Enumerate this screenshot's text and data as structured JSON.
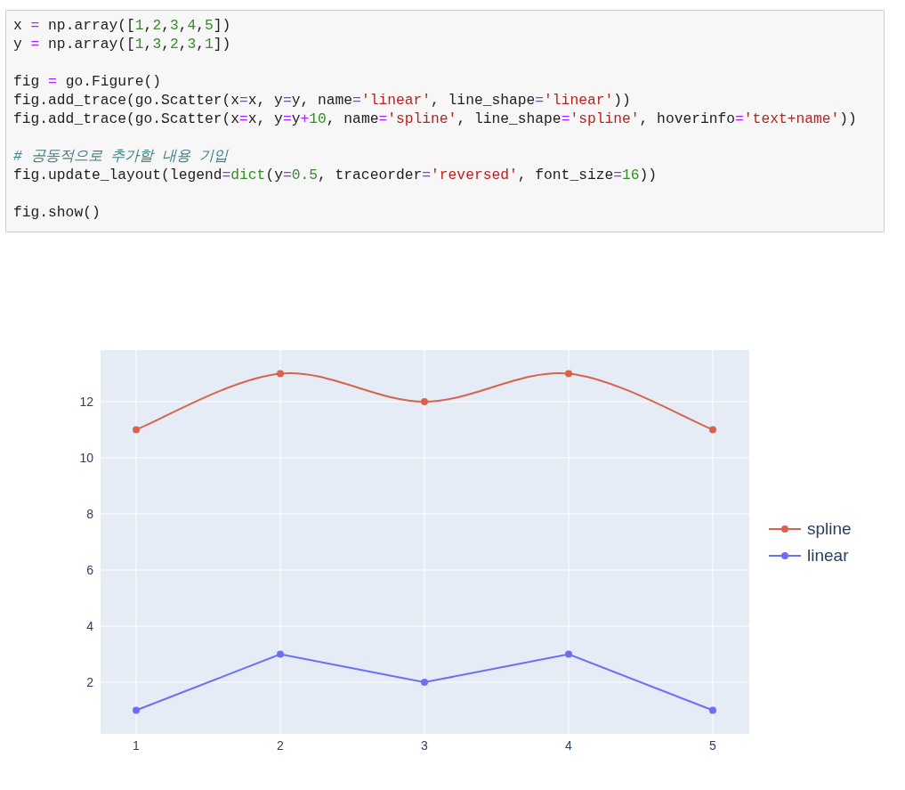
{
  "code_cell": {
    "blocks": [
      {
        "lines": [
          {
            "tokens": [
              {
                "kind": "plain",
                "text": "x "
              },
              {
                "kind": "op",
                "text": "="
              },
              {
                "kind": "plain",
                "text": " np.array(["
              },
              {
                "kind": "num",
                "text": "1"
              },
              {
                "kind": "plain",
                "text": ","
              },
              {
                "kind": "num",
                "text": "2"
              },
              {
                "kind": "plain",
                "text": ","
              },
              {
                "kind": "num",
                "text": "3"
              },
              {
                "kind": "plain",
                "text": ","
              },
              {
                "kind": "num",
                "text": "4"
              },
              {
                "kind": "plain",
                "text": ","
              },
              {
                "kind": "num",
                "text": "5"
              },
              {
                "kind": "plain",
                "text": "])"
              }
            ]
          },
          {
            "tokens": [
              {
                "kind": "plain",
                "text": "y "
              },
              {
                "kind": "op",
                "text": "="
              },
              {
                "kind": "plain",
                "text": " np.array(["
              },
              {
                "kind": "num",
                "text": "1"
              },
              {
                "kind": "plain",
                "text": ","
              },
              {
                "kind": "num",
                "text": "3"
              },
              {
                "kind": "plain",
                "text": ","
              },
              {
                "kind": "num",
                "text": "2"
              },
              {
                "kind": "plain",
                "text": ","
              },
              {
                "kind": "num",
                "text": "3"
              },
              {
                "kind": "plain",
                "text": ","
              },
              {
                "kind": "num",
                "text": "1"
              },
              {
                "kind": "plain",
                "text": "])"
              }
            ]
          }
        ]
      },
      {
        "lines": [
          {
            "tokens": [
              {
                "kind": "plain",
                "text": "fig "
              },
              {
                "kind": "op",
                "text": "="
              },
              {
                "kind": "plain",
                "text": " go.Figure()"
              }
            ]
          },
          {
            "tokens": [
              {
                "kind": "plain",
                "text": "fig.add_trace(go.Scatter(x"
              },
              {
                "kind": "op",
                "text": "="
              },
              {
                "kind": "plain",
                "text": "x, y"
              },
              {
                "kind": "op",
                "text": "="
              },
              {
                "kind": "plain",
                "text": "y, name"
              },
              {
                "kind": "op",
                "text": "="
              },
              {
                "kind": "str",
                "text": "'linear'"
              },
              {
                "kind": "plain",
                "text": ", line_shape"
              },
              {
                "kind": "op",
                "text": "="
              },
              {
                "kind": "str",
                "text": "'linear'"
              },
              {
                "kind": "plain",
                "text": "))"
              }
            ]
          },
          {
            "tokens": [
              {
                "kind": "plain",
                "text": "fig.add_trace(go.Scatter(x"
              },
              {
                "kind": "op",
                "text": "="
              },
              {
                "kind": "plain",
                "text": "x, y"
              },
              {
                "kind": "op",
                "text": "="
              },
              {
                "kind": "plain",
                "text": "y"
              },
              {
                "kind": "op",
                "text": "+"
              },
              {
                "kind": "num",
                "text": "10"
              },
              {
                "kind": "plain",
                "text": ", name"
              },
              {
                "kind": "op",
                "text": "="
              },
              {
                "kind": "str",
                "text": "'spline'"
              },
              {
                "kind": "plain",
                "text": ", line_shape"
              },
              {
                "kind": "op",
                "text": "="
              },
              {
                "kind": "str",
                "text": "'spline'"
              },
              {
                "kind": "plain",
                "text": ", hoverinfo"
              },
              {
                "kind": "op",
                "text": "="
              },
              {
                "kind": "str",
                "text": "'text+name'"
              },
              {
                "kind": "plain",
                "text": "))"
              }
            ]
          }
        ]
      },
      {
        "lines": [
          {
            "tokens": [
              {
                "kind": "comment",
                "text": "# 공동적으로 추가할 내용 기입"
              }
            ]
          },
          {
            "tokens": [
              {
                "kind": "plain",
                "text": "fig.update_layout(legend"
              },
              {
                "kind": "op",
                "text": "="
              },
              {
                "kind": "builtin",
                "text": "dict"
              },
              {
                "kind": "plain",
                "text": "(y"
              },
              {
                "kind": "op",
                "text": "="
              },
              {
                "kind": "num",
                "text": "0.5"
              },
              {
                "kind": "plain",
                "text": ", traceorder"
              },
              {
                "kind": "op",
                "text": "="
              },
              {
                "kind": "str",
                "text": "'reversed'"
              },
              {
                "kind": "plain",
                "text": ", font_size"
              },
              {
                "kind": "op",
                "text": "="
              },
              {
                "kind": "num",
                "text": "16"
              },
              {
                "kind": "plain",
                "text": "))"
              }
            ]
          }
        ]
      },
      {
        "lines": [
          {
            "tokens": [
              {
                "kind": "plain",
                "text": "fig.show()"
              }
            ]
          }
        ]
      }
    ]
  },
  "figure": {
    "line_styles": [
      {
        "kind": "spline"
      },
      {
        "kind": "linear"
      }
    ],
    "chart_data": {
      "type": "line",
      "grid": true,
      "legend": "right",
      "x": [
        1,
        2,
        3,
        4,
        5
      ],
      "xlim": [
        0.753,
        5.253
      ],
      "ylim": [
        0.16,
        13.84
      ],
      "xticks": [
        {
          "value": 1,
          "label": "1"
        },
        {
          "value": 2,
          "label": "2"
        },
        {
          "value": 3,
          "label": "3"
        },
        {
          "value": 4,
          "label": "4"
        },
        {
          "value": 5,
          "label": "5"
        }
      ],
      "yticks": [
        {
          "value": 2,
          "label": "2"
        },
        {
          "value": 4,
          "label": "4"
        },
        {
          "value": 6,
          "label": "6"
        },
        {
          "value": 8,
          "label": "8"
        },
        {
          "value": 10,
          "label": "10"
        },
        {
          "value": 12,
          "label": "12"
        }
      ],
      "series": [
        {
          "name": "spline",
          "color": "#d7634c",
          "marker": "circle",
          "values": [
            11,
            13,
            12,
            13,
            11
          ]
        },
        {
          "name": "linear",
          "color": "#6c6ff5",
          "marker": "circle",
          "values": [
            1,
            3,
            2,
            3,
            1
          ]
        }
      ]
    }
  }
}
